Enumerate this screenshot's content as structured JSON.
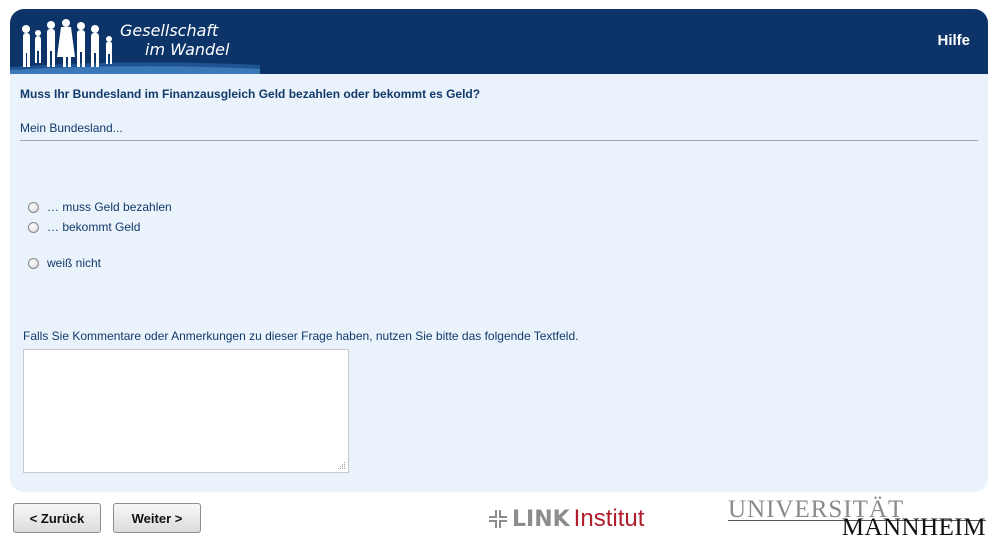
{
  "header": {
    "logo_line1": "Gesellschaft",
    "logo_line2": "im Wandel",
    "help_label": "Hilfe"
  },
  "question": {
    "text": "Muss Ihr Bundesland im Finanzausgleich Geld bezahlen oder bekommt es Geld?",
    "subtext": "Mein Bundesland..."
  },
  "options": [
    {
      "label": "… muss Geld bezahlen",
      "selected": false
    },
    {
      "label": "… bekommt Geld",
      "selected": false
    },
    {
      "label": "weiß nicht",
      "selected": false
    }
  ],
  "comment": {
    "label": "Falls Sie Kommentare oder Anmerkungen zu dieser Frage haben, nutzen Sie bitte das folgende Textfeld.",
    "value": ""
  },
  "nav": {
    "back_label": "< Zurück",
    "next_label": "Weiter >"
  },
  "footer": {
    "link_word": "LINK",
    "link_inst": "Institut",
    "uni_top": "UNIVERSITÄT",
    "uni_bottom": "MANNHEIM"
  },
  "colors": {
    "header_bg": "#0c3468",
    "panel_bg": "#eaf2fb",
    "text_blue": "#123a6b",
    "link_red": "#b01e2d"
  },
  "icons": [
    "people-silhouette-icon",
    "radio-icon",
    "resize-grip-icon",
    "link-cross-icon"
  ]
}
